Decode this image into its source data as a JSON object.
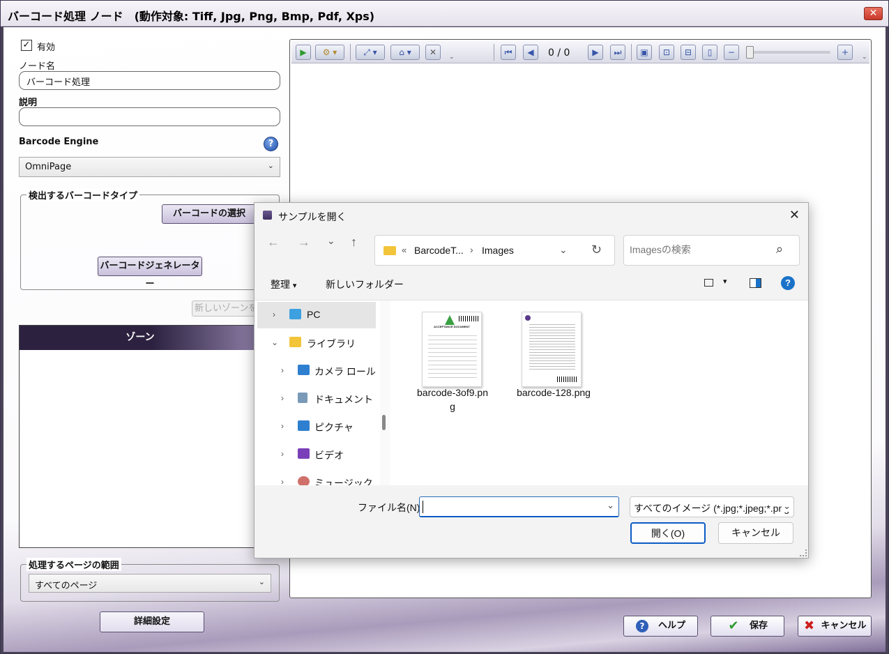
{
  "window": {
    "title": "バーコード処理 ノード　(動作対象: Tiff, Jpg, Png, Bmp, Pdf, Xps)",
    "close_glyph": "✕"
  },
  "left": {
    "enabled_label": "有効",
    "enabled_check": "✓",
    "node_name_label": "ノード名",
    "node_name_value": "バーコード処理",
    "description_label": "説明",
    "description_value": "",
    "engine_label": "Barcode Engine",
    "help_glyph": "?",
    "engine_value": "OmniPage",
    "chevron": "⌄",
    "barcode_group_title": "検出するバーコードタイプ",
    "select_barcode_button": "バーコードの選択",
    "generator_button": "バーコードジェネレーター",
    "new_zone_button": "新しいゾーンを追",
    "zone_header": "ゾーン",
    "page_range_title": "処理するページの範囲",
    "page_range_value": "すべてのページ",
    "advanced_button": "詳細設定"
  },
  "viewer": {
    "page_indicator": "0 / 0"
  },
  "bottom_buttons": {
    "help": "ヘルプ",
    "save": "保存",
    "cancel": "キャンセル"
  },
  "dialog": {
    "title": "サンプルを開く",
    "close": "✕",
    "back": "←",
    "forward": "→",
    "recent": "⌄",
    "up": "↑",
    "address_prefix": "«",
    "address_parent": "BarcodeT...",
    "address_sep": "›",
    "address_current": "Images",
    "refresh": "↻",
    "search_placeholder": "Imagesの検索",
    "search_icon": "⌕",
    "organize": "整理",
    "organize_chevron": "▾",
    "new_folder": "新しいフォルダー",
    "view_chevron": "▾",
    "help": "?",
    "tree": [
      {
        "label": "PC",
        "arrow": "›",
        "icon": "monitor-icon"
      },
      {
        "label": "ライブラリ",
        "arrow": "⌄",
        "icon": "folder-icon"
      },
      {
        "label": "カメラ ロール",
        "arrow": "›",
        "icon": "picture-icon"
      },
      {
        "label": "ドキュメント",
        "arrow": "›",
        "icon": "document-icon"
      },
      {
        "label": "ピクチャ",
        "arrow": "›",
        "icon": "picture-icon"
      },
      {
        "label": "ビデオ",
        "arrow": "›",
        "icon": "video-icon"
      },
      {
        "label": "ミュージック",
        "arrow": "›",
        "icon": "music-icon"
      }
    ],
    "files": [
      {
        "name_line1": "barcode-3of9.pn",
        "name_line2": "g",
        "thumb_title": "ACCEPTANCE DOCUMENT"
      },
      {
        "name_line1": "barcode-128.png",
        "name_line2": ""
      }
    ],
    "filename_label": "ファイル名(N):",
    "filename_value": "",
    "filetype_value": "すべてのイメージ (*.jpg;*.jpeg;*.png",
    "open_button": "開く(O)",
    "cancel_button": "キャンセル"
  },
  "colors": {
    "accent": "#0a5bc4",
    "zone_header": "#2c2240",
    "button_border": "#5a5070"
  }
}
